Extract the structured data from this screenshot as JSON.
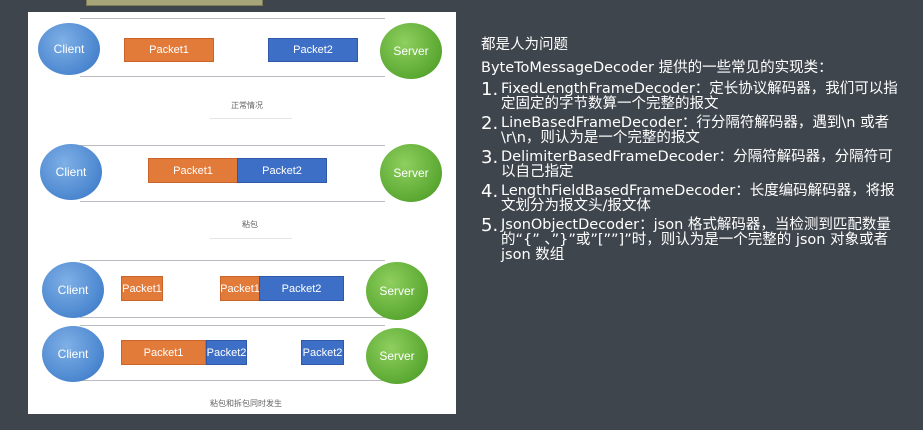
{
  "diagram": {
    "client_label": "Client",
    "server_label": "Server",
    "scenario1": {
      "packet1": "Packet1",
      "packet2": "Packet2",
      "caption": "正常情况"
    },
    "scenario2": {
      "packet1": "Packet1",
      "packet2": "Packet2",
      "caption": "粘包"
    },
    "scenario3": {
      "row1": {
        "packet1": "Packet1",
        "packet1_part": "Packet1",
        "packet2": "Packet2"
      },
      "row2": {
        "packet1": "Packet1",
        "packet2_part": "Packet2",
        "packet2_rest": "Packet2"
      },
      "caption": "粘包和拆包同时发生"
    }
  },
  "notes": {
    "title": "都是人为问题",
    "intro": "ByteToMessageDecoder 提供的一些常见的实现类：",
    "items": [
      {
        "num": "1.",
        "text": "FixedLengthFrameDecoder：定长协议解码器，我们可以指定固定的字节数算一个完整的报文"
      },
      {
        "num": "2.",
        "text": "LineBasedFrameDecoder：行分隔符解码器，遇到\\n 或者\\r\\n，则认为是一个完整的报文"
      },
      {
        "num": "3.",
        "text": "DelimiterBasedFrameDecoder：分隔符解码器，分隔符可以自己指定"
      },
      {
        "num": "4.",
        "text": "LengthFieldBasedFrameDecoder：长度编码解码器，将报文划分为报文头/报文体"
      },
      {
        "num": "5.",
        "text": "JsonObjectDecoder：json 格式解码器，当检测到匹配数量的“{” 、”}”或”[””]”时，则认为是一个完整的 json 对象或者 json 数组"
      }
    ]
  }
}
